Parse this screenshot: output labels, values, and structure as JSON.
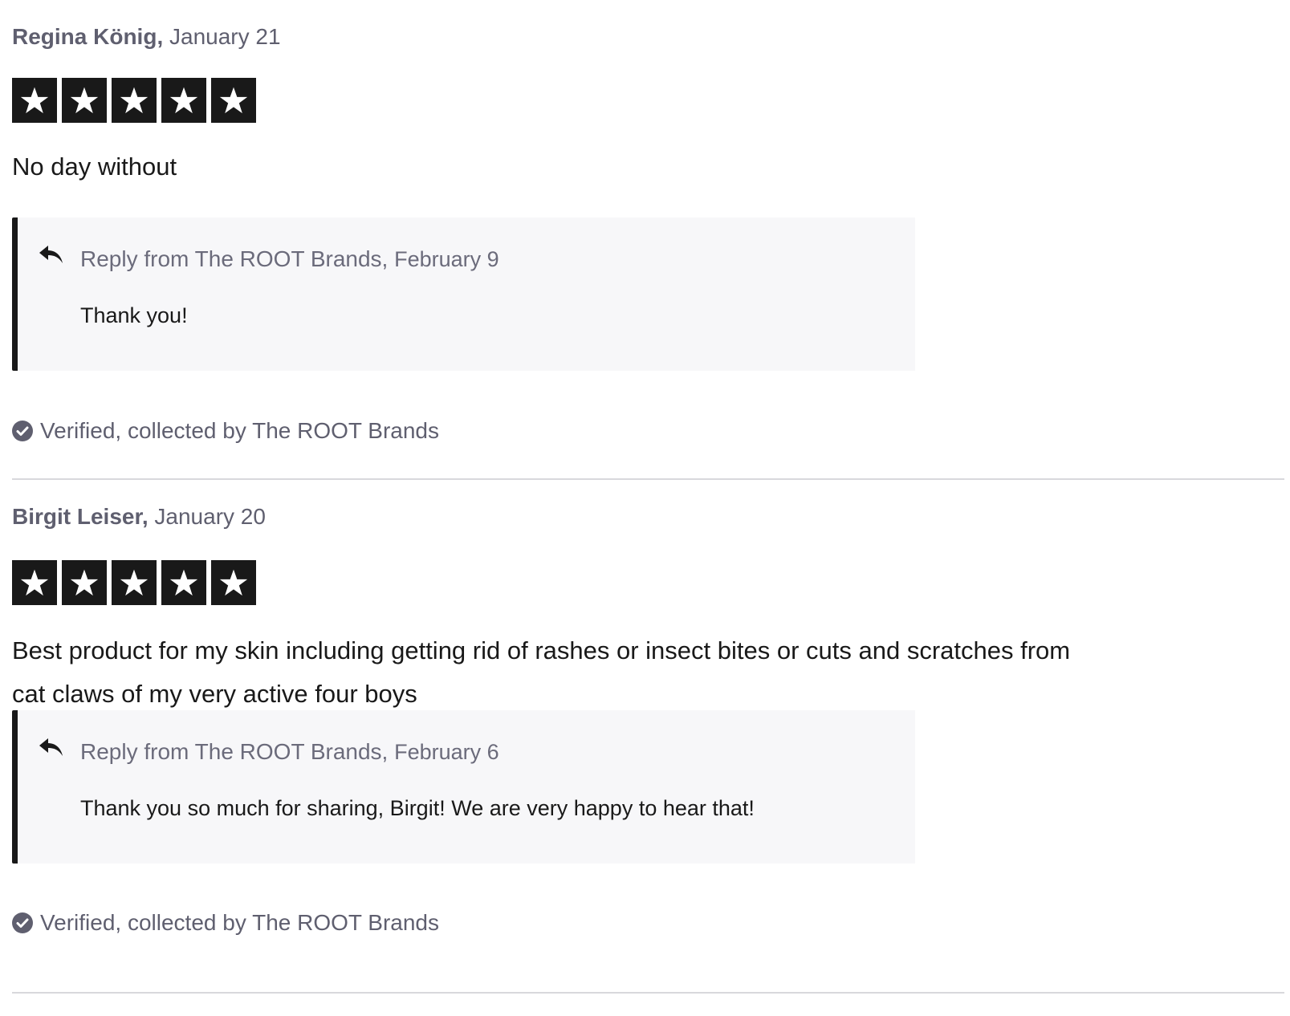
{
  "colors": {
    "star_background": "#191919",
    "star_fill": "#ffffff",
    "reply_background": "#f7f7f9",
    "reply_border": "#191919",
    "muted_text": "#5f5f6f",
    "divider": "#d8d8dc"
  },
  "reviews": [
    {
      "reviewer_name": "Regina König,",
      "date": "January 21",
      "rating": 5,
      "rating_max": 5,
      "text": "No day without",
      "reply": {
        "icon": "reply-arrow-icon",
        "author": "Reply from The ROOT Brands,",
        "date": "February 9",
        "text": "Thank you!"
      },
      "verified": {
        "icon": "check-circle-icon",
        "text": "Verified, collected by The ROOT Brands"
      }
    },
    {
      "reviewer_name": "Birgit Leiser,",
      "date": "January 20",
      "rating": 5,
      "rating_max": 5,
      "text": "Best product for my skin including getting rid of rashes or insect bites or cuts and scratches from cat claws of my very active four boys",
      "reply": {
        "icon": "reply-arrow-icon",
        "author": "Reply from The ROOT Brands,",
        "date": "February 6",
        "text": "Thank you so much for sharing, Birgit! We are very happy to hear that!"
      },
      "verified": {
        "icon": "check-circle-icon",
        "text": "Verified, collected by The ROOT Brands"
      }
    }
  ]
}
